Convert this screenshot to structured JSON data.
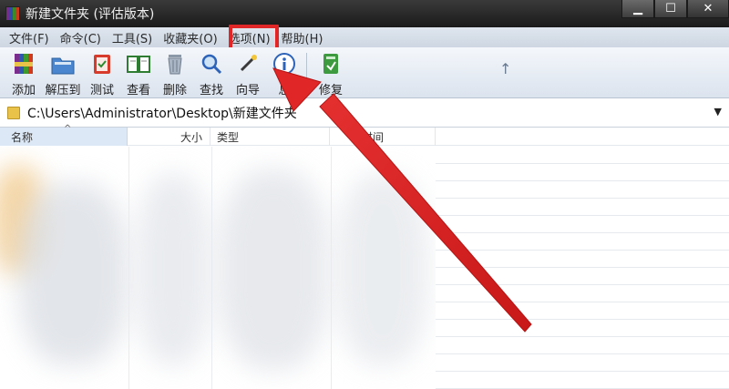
{
  "window": {
    "title": "新建文件夹 (评估版本)",
    "controls": {
      "minimize": "▁",
      "maximize": "☐",
      "close": "✕"
    }
  },
  "menu": {
    "items": [
      "文件(F)",
      "命令(C)",
      "工具(S)",
      "收藏夹(O)",
      "选项(N)",
      "帮助(H)"
    ],
    "highlighted": "选项(N)",
    "highlight_color": "#e02626"
  },
  "toolbar": {
    "buttons": [
      {
        "label": "添加",
        "icon": "add-archive-icon"
      },
      {
        "label": "解压到",
        "icon": "extract-to-icon"
      },
      {
        "label": "测试",
        "icon": "test-clipboard-icon"
      },
      {
        "label": "查看",
        "icon": "view-book-icon"
      },
      {
        "label": "删除",
        "icon": "delete-trash-icon"
      },
      {
        "label": "查找",
        "icon": "find-magnifier-icon"
      },
      {
        "label": "向导",
        "icon": "wizard-wand-icon"
      },
      {
        "label": "息",
        "icon": "info-icon"
      },
      {
        "label": "修复",
        "icon": "repair-icon"
      }
    ],
    "up_glyph": "↑"
  },
  "address": {
    "path": "C:\\Users\\Administrator\\Desktop\\新建文件夹",
    "dropdown_glyph": "▼"
  },
  "columns": {
    "name": "名称",
    "size": "大小",
    "type": "类型",
    "modified": "改时间"
  },
  "colors": {
    "titlebar": "#2a2a2a",
    "menubar": "#d6dee8",
    "toolbar": "#e8eef5",
    "arrow": "#e02626"
  }
}
